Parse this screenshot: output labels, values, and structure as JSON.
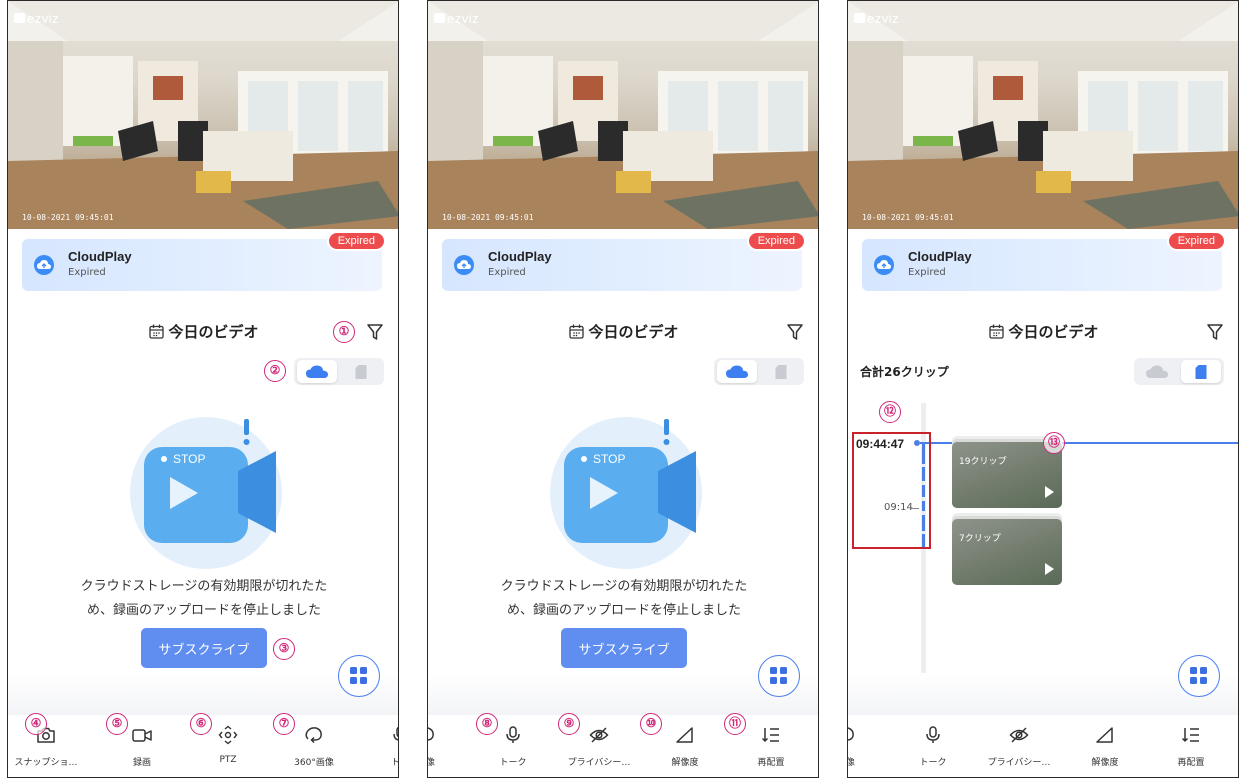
{
  "brand": "ezviz",
  "timestamp": "10-08-2021  09:45:01",
  "cloud": {
    "title": "CloudPlay",
    "status": "Expired",
    "tag": "Expired"
  },
  "section_title": "今日のビデオ",
  "clips_total": "合計26クリップ",
  "message_lines": [
    "クラウドストレージの有効期限が切れたた",
    "め、録画のアップロードを停止しました"
  ],
  "stop_label": "STOP",
  "subscribe_label": "サブスクライブ",
  "toolbar_p1": [
    "スナップショ…",
    "録画",
    "PTZ",
    "360°画像",
    "ト…"
  ],
  "toolbar_p2": [
    "画像",
    "トーク",
    "プライバシー…",
    "解像度",
    "再配置"
  ],
  "timeline": {
    "current_time": "09:44:47",
    "tick_label": "09:14"
  },
  "clips": [
    "19クリップ",
    "7クリップ"
  ],
  "callouts": [
    "①",
    "②",
    "③",
    "④",
    "⑤",
    "⑥",
    "⑦",
    "⑧",
    "⑨",
    "⑩",
    "⑪",
    "⑫",
    "⑬"
  ],
  "colors": {
    "accent": "#5f8ef0",
    "expired": "#ee4c4c",
    "callout": "#d1287a",
    "highlight_box": "#c8232c"
  }
}
